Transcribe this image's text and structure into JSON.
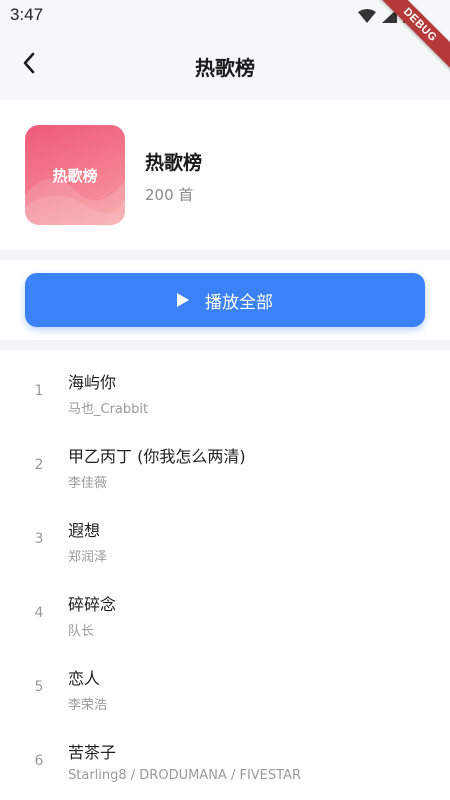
{
  "status_bar": {
    "time": "3:47",
    "icons": [
      "wifi-icon",
      "signal-icon",
      "battery-icon"
    ]
  },
  "debug_banner": "DEBUG",
  "app_bar": {
    "title": "热歌榜",
    "back_icon": "chevron-left-icon"
  },
  "playlist": {
    "cover_label": "热歌榜",
    "name": "热歌榜",
    "count": "200 首"
  },
  "play_all": {
    "label": "播放全部",
    "icon": "play-icon"
  },
  "songs": [
    {
      "index": "1",
      "title": "海屿你",
      "artist": "马也_Crabbit"
    },
    {
      "index": "2",
      "title": "甲乙丙丁 (你我怎么两清)",
      "artist": "李佳薇"
    },
    {
      "index": "3",
      "title": "遐想",
      "artist": "郑润泽"
    },
    {
      "index": "4",
      "title": "碎碎念",
      "artist": "队长"
    },
    {
      "index": "5",
      "title": "恋人",
      "artist": "李荣浩"
    },
    {
      "index": "6",
      "title": "苦茶子",
      "artist": "Starling8 / DRODUMANA / FIVESTAR"
    }
  ],
  "colors": {
    "accent": "#3b82f6",
    "cover_gradient_start": "#ef5a79",
    "cover_gradient_end": "#f6a0a4",
    "debug_ribbon": "#b43a3a"
  }
}
